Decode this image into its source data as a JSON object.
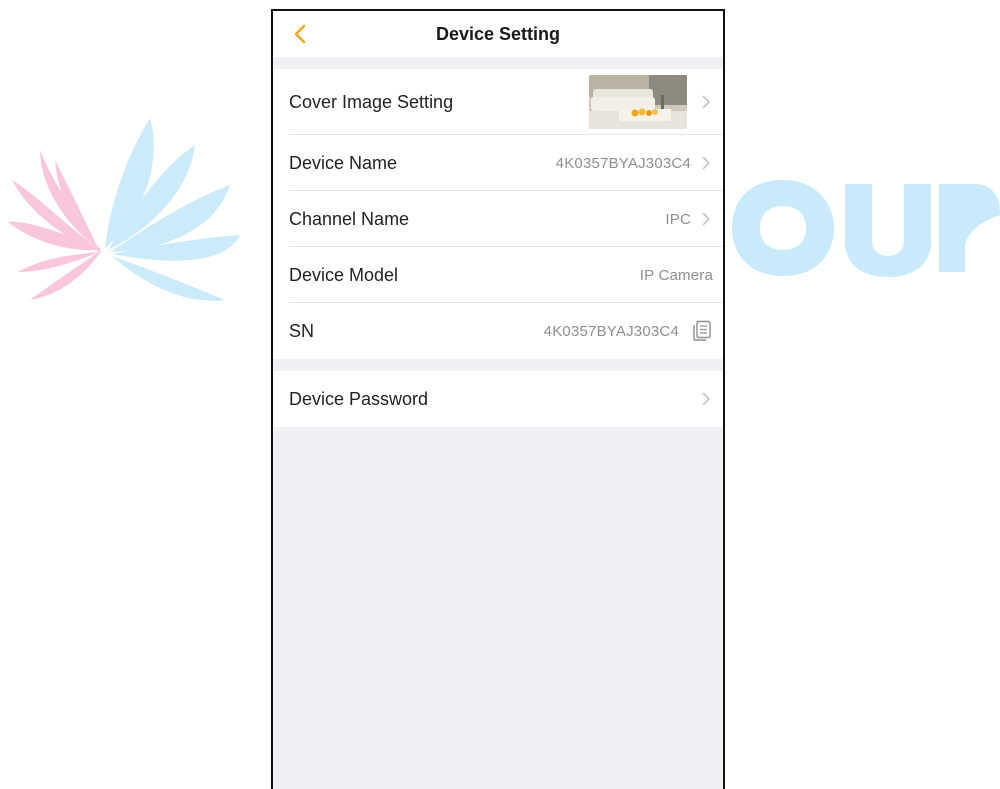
{
  "watermark": {
    "text": "OUP",
    "color_blue": "#c9eafb",
    "color_pink": "#f9c5dc"
  },
  "nav": {
    "back_icon": "chevron-left-icon",
    "title": "Device Setting",
    "accent": "#f5a623"
  },
  "settings": {
    "cover_image": {
      "label": "Cover Image Setting",
      "thumbnail_icon": "living-room-photo"
    },
    "device_name": {
      "label": "Device Name",
      "value": "4K0357BYAJ303C4"
    },
    "channel_name": {
      "label": "Channel Name",
      "value": "IPC"
    },
    "device_model": {
      "label": "Device Model",
      "value": "IP Camera"
    },
    "sn": {
      "label": "SN",
      "value": "4K0357BYAJ303C4",
      "copy_icon": "copy-icon"
    },
    "device_password": {
      "label": "Device Password"
    }
  }
}
